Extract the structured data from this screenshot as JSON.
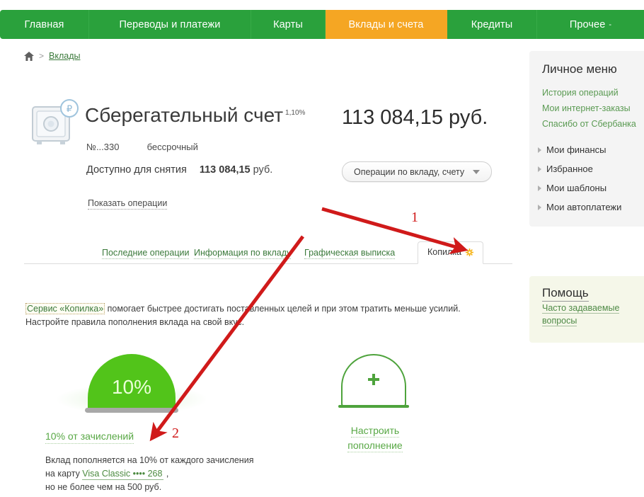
{
  "topnav": {
    "items": [
      {
        "label": "Главная",
        "active": false,
        "caret": ""
      },
      {
        "label": "Переводы и платежи",
        "active": false,
        "caret": ""
      },
      {
        "label": "Карты",
        "active": false,
        "caret": ""
      },
      {
        "label": "Вклады и счета",
        "active": true,
        "caret": ""
      },
      {
        "label": "Кредиты",
        "active": false,
        "caret": ""
      },
      {
        "label": "Прочее",
        "active": false,
        "caret": "-"
      }
    ],
    "accent_green": "#2aa13c",
    "accent_orange": "#f5a623"
  },
  "breadcrumb": {
    "home_icon": "home-icon",
    "separator": ">",
    "link": "Вклады"
  },
  "account": {
    "icon": "safe-icon",
    "title": "Сберегательный счет",
    "rate": "1,10%",
    "number": "№...330",
    "term": "бессрочный",
    "available_label": "Доступно для снятия",
    "available_amount": "113 084,15",
    "currency": "руб.",
    "show_operations": "Показать операции",
    "balance": "113 084,15 руб.",
    "operations_button": "Операции по вкладу, счету",
    "operations_caret": "chevron-down-icon"
  },
  "tabs": [
    {
      "label": "Последние операции",
      "active": false
    },
    {
      "label": "Информация по вкладу",
      "active": false
    },
    {
      "label": "Графическая выписка",
      "active": false
    },
    {
      "label": "Копилка",
      "active": true,
      "icon": "gear-icon"
    }
  ],
  "description": {
    "link": "Сервис «Копилка»",
    "text": " помогает быстрее достигать поставленных целей и при этом тратить меньше усилий. Настройте правила пополнения вклада на свой вкус."
  },
  "widgets": {
    "percent": {
      "dome_value": "10%",
      "link": "10% от зачислений",
      "note_part1": "Вклад пополняется на 10% от каждого зачисления на карту ",
      "card_link": "Visa Classic •••• 268",
      "note_part2": " ,",
      "note_part3": "но не более чем на 500 руб.",
      "color": "#52c41a"
    },
    "add": {
      "icon": "plus-icon",
      "label_line1": "Настроить",
      "label_line2": "пополнение",
      "color": "#4ea33c"
    }
  },
  "sidebar": {
    "title": "Личное меню",
    "links": [
      "История операций",
      "Мои интернет-заказы",
      "Спасибо от Сбербанка"
    ],
    "rows": [
      "Мои финансы",
      "Избранное",
      "Мои шаблоны",
      "Мои автоплатежи"
    ]
  },
  "help": {
    "title": "Помощь",
    "link": "Часто задаваемые вопросы"
  },
  "annotations": {
    "color": "#d01a1a",
    "markers": [
      {
        "id": 1,
        "label": "1"
      },
      {
        "id": 2,
        "label": "2"
      }
    ]
  }
}
